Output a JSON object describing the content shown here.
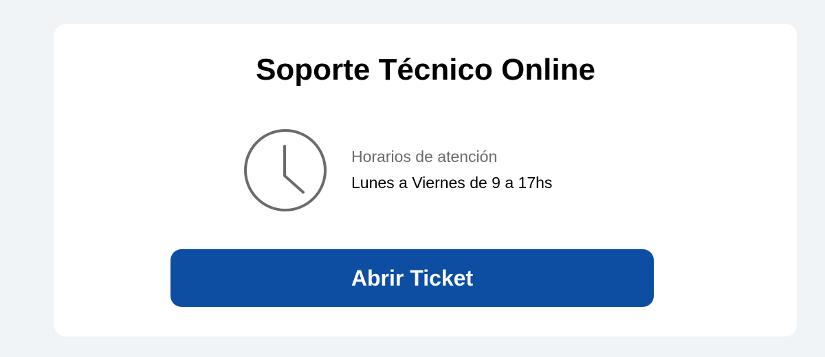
{
  "card": {
    "title": "Soporte Técnico Online"
  },
  "schedule": {
    "icon": "clock-icon",
    "label": "Horarios de atención",
    "value": "Lunes a Viernes de 9 a 17hs"
  },
  "actions": {
    "open_ticket_label": "Abrir Ticket"
  },
  "colors": {
    "page_background": "#f1f4f7",
    "card_background": "#ffffff",
    "button_background": "#0d4ea3",
    "icon_stroke": "#6b6b6b"
  }
}
